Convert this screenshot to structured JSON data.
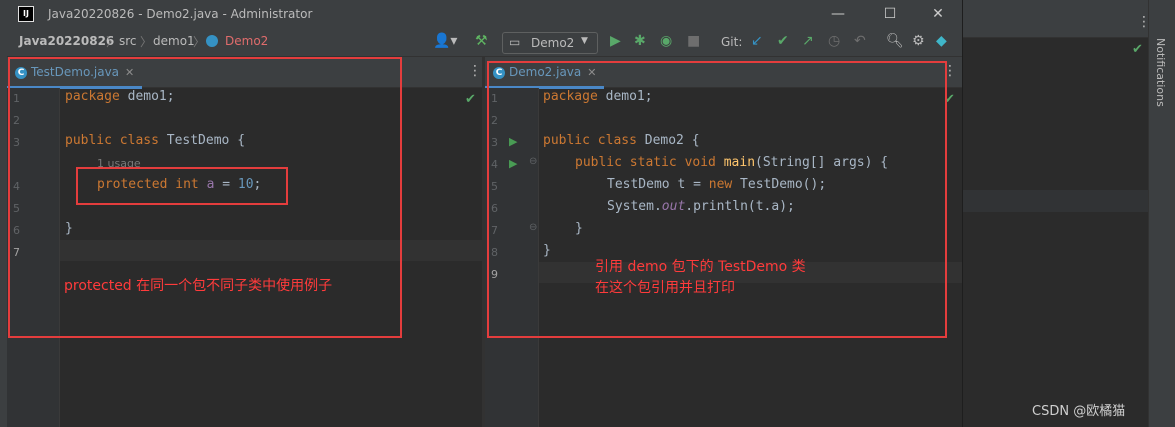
{
  "window": {
    "title": "Java20220826 - Demo2.java - Administrator",
    "app_icon": "IJ"
  },
  "breadcrumb": {
    "project": "Java20220826",
    "folder": "src",
    "package": "demo1",
    "file": "Demo2"
  },
  "toolbar": {
    "run_config": "Demo2",
    "git_label": "Git:"
  },
  "icons": {
    "app": "intellij-icon",
    "minimize": "minimize-icon",
    "maximize": "maximize-icon",
    "close": "close-icon",
    "user": "user-icon",
    "build": "hammer-icon",
    "run": "run-icon",
    "debug": "debug-icon",
    "stop": "stop-icon",
    "git_update": "git-update-icon",
    "git_commit": "git-commit-icon",
    "git_push": "git-push-icon",
    "history": "history-icon",
    "rollback": "rollback-icon",
    "search": "search-icon",
    "settings": "gear-icon",
    "plugin": "plugin-icon"
  },
  "left_editor": {
    "tab": "TestDemo.java",
    "usage_hint": "1 usage",
    "line_numbers": [
      "1",
      "2",
      "3",
      "4",
      "5",
      "6",
      "7"
    ],
    "lines": {
      "l1_kw": "package",
      "l1_rest": " demo1;",
      "l3_kw": "public class",
      "l3_rest": " TestDemo {",
      "l4_kw": "protected int",
      "l4_var": "a",
      "l4_eq": " = ",
      "l4_num": "10",
      "l4_end": ";",
      "l6": "}"
    },
    "note": "protected 在同一个包不同子类中使用例子"
  },
  "right_editor": {
    "tab": "Demo2.java",
    "line_numbers": [
      "1",
      "2",
      "3",
      "4",
      "5",
      "6",
      "7",
      "8",
      "9"
    ],
    "lines": {
      "l1_kw": "package",
      "l1_rest": " demo1;",
      "l3_kw": "public class",
      "l3_rest": " Demo2 {",
      "l4_kw": "public static void",
      "l4_fn": "main",
      "l4_rest": "(String[] args) {",
      "l5_a": "TestDemo t = ",
      "l5_kw": "new",
      "l5_b": " TestDemo();",
      "l6_a": "System.",
      "l6_fld": "out",
      "l6_b": ".println(t.a);",
      "l7": "}",
      "l8": "}"
    },
    "note_line1": "引用 demo 包下的 TestDemo 类",
    "note_line2": "在这个包引用并且打印"
  },
  "sidebar": {
    "notifications": "Notifications"
  },
  "watermark": "CSDN @欧橘猫",
  "colors": {
    "keyword": "#cc7832",
    "number": "#6897bb",
    "method": "#ffc66d",
    "field": "#9876aa",
    "annotation_red": "#e43d3d",
    "check_green": "#59a869"
  }
}
